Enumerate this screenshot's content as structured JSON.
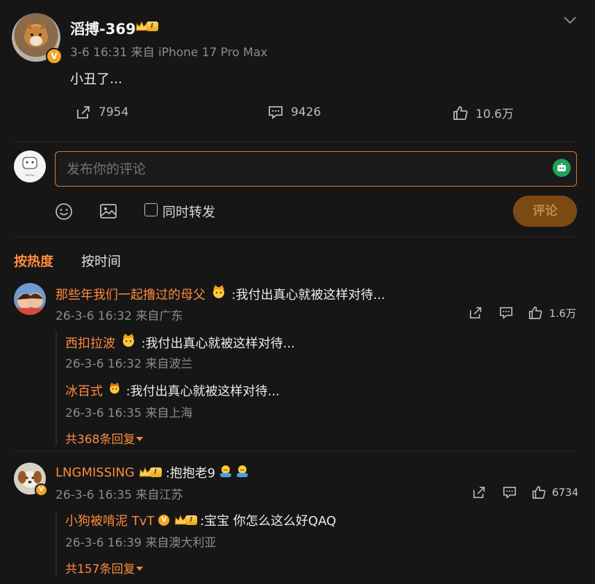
{
  "post": {
    "author": "滔搏-369",
    "vip_level": "I",
    "meta": "3-6 16:31 来自 iPhone 17 Pro Max",
    "text": "小丑了...",
    "repost_count": "7954",
    "comment_count": "9426",
    "like_count": "10.6万"
  },
  "composer": {
    "placeholder": "发布你的评论",
    "sync_repost_label": "同时转发",
    "submit_label": "评论"
  },
  "sort": {
    "hot": "按热度",
    "time": "按时间"
  },
  "comments": [
    {
      "author": "那些年我们一起撸过的母父",
      "text": ":我付出真心就被这样对待...",
      "meta": "26-3-6 16:32 来自广东",
      "likes": "1.6万",
      "replies": [
        {
          "author": "西扣拉波",
          "text": ":我付出真心就被这样对待...",
          "meta": "26-3-6 16:32 来自波兰"
        },
        {
          "author": "冰百式",
          "text": ":我付出真心就被这样对待...",
          "meta": "26-3-6 16:35 来自上海"
        }
      ],
      "more_replies": "共368条回复"
    },
    {
      "author": "LNGMISSING",
      "vip_level": "I",
      "text": ":抱抱老9",
      "meta": "26-3-6 16:35 来自江苏",
      "likes": "6734",
      "replies": [
        {
          "author": "小狗被啃泥 TvT",
          "vip_level": "I",
          "text": ":宝宝 你怎么这么好QAQ",
          "meta": "26-3-6 16:39 来自澳大利亚"
        }
      ],
      "more_replies": "共157条回复"
    }
  ],
  "colors": {
    "accent": "#ff8a3d",
    "submit_bg": "#7a4a12",
    "background": "#161616"
  }
}
